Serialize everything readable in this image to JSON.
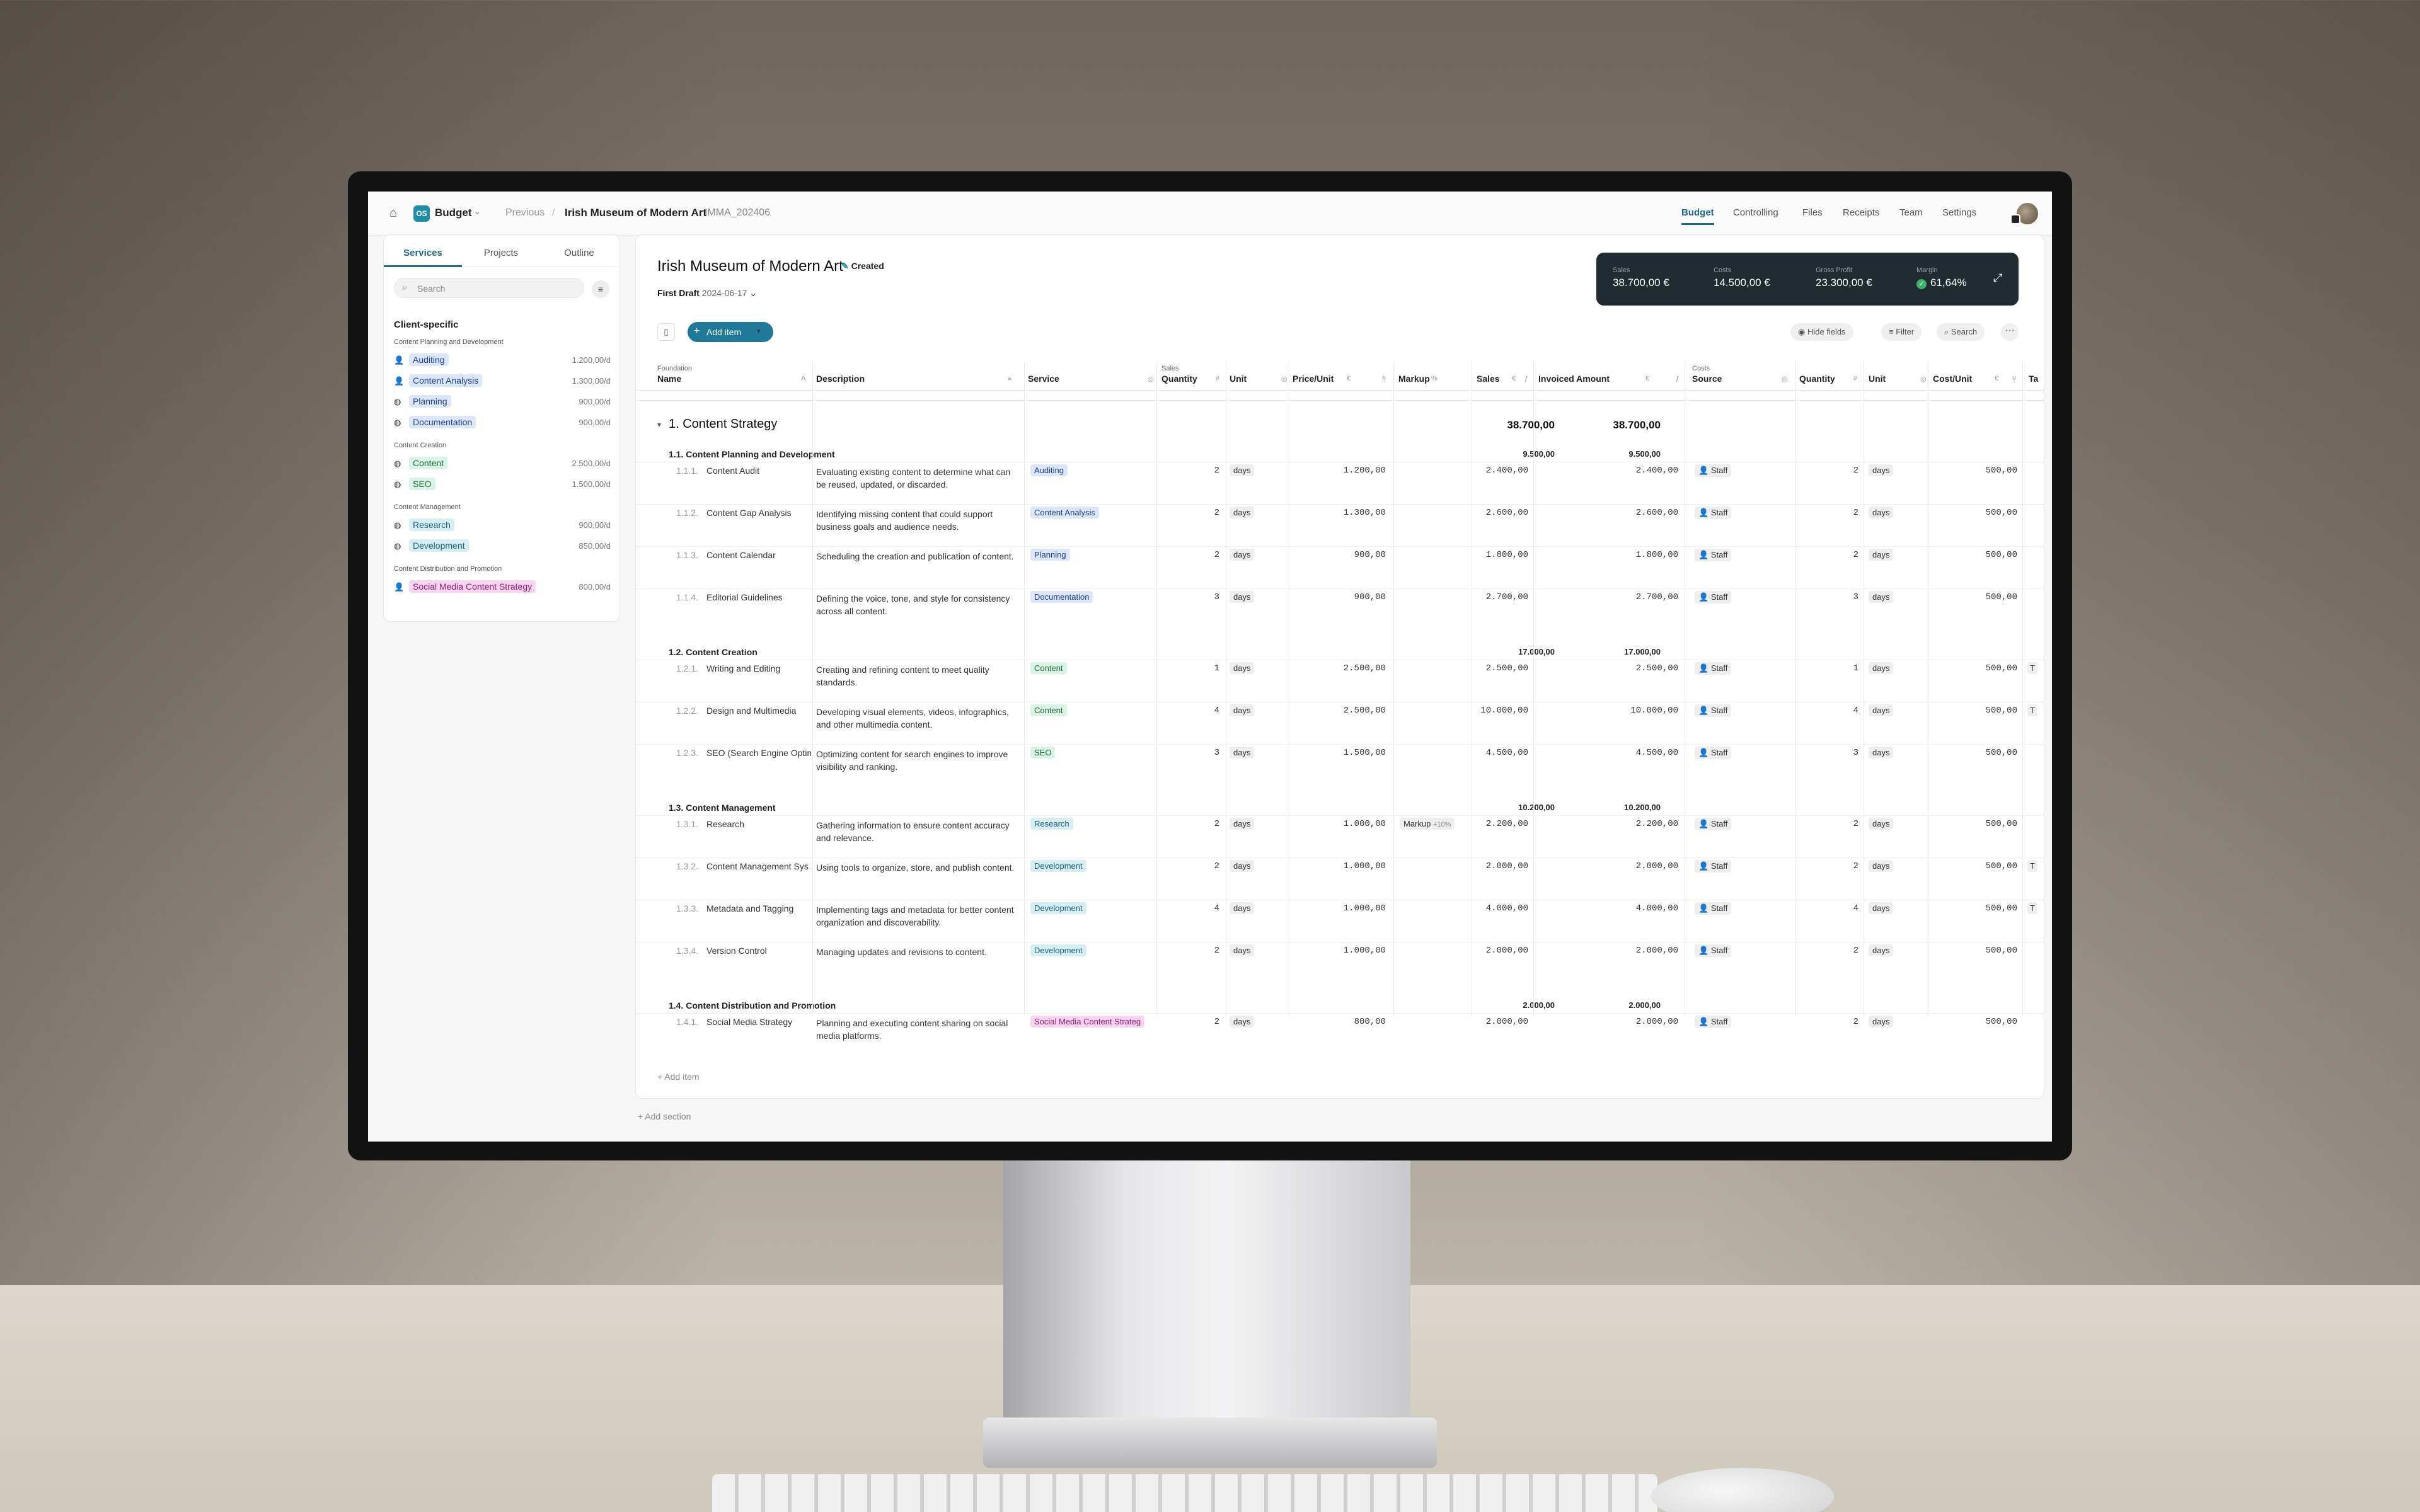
{
  "topbar": {
    "logo": "OS",
    "module": "Budget",
    "previous": "Previous",
    "separator": "/",
    "project": "Irish Museum of Modern Art",
    "code": "IMMA_202406",
    "nav": [
      "Budget",
      "Controlling",
      "Files",
      "Receipts",
      "Team",
      "Settings"
    ]
  },
  "sidebar": {
    "tabs": [
      "Services",
      "Projects",
      "Outline"
    ],
    "search_placeholder": "Search",
    "title": "Client-specific",
    "groups": [
      {
        "name": "Content Planning and Development",
        "items": [
          {
            "label": "Auditing",
            "rate": "1.200,00/d",
            "icon": "person-icon",
            "color": "blue"
          },
          {
            "label": "Content Analysis",
            "rate": "1.300,00/d",
            "icon": "person-icon",
            "color": "blue"
          },
          {
            "label": "Planning",
            "rate": "900,00/d",
            "icon": "globe-icon",
            "color": "blue"
          },
          {
            "label": "Documentation",
            "rate": "900,00/d",
            "icon": "globe-icon",
            "color": "blue"
          }
        ]
      },
      {
        "name": "Content Creation",
        "items": [
          {
            "label": "Content",
            "rate": "2.500,00/d",
            "icon": "globe-icon",
            "color": "green"
          },
          {
            "label": "SEO",
            "rate": "1.500,00/d",
            "icon": "globe-icon",
            "color": "green"
          }
        ]
      },
      {
        "name": "Content Management",
        "items": [
          {
            "label": "Research",
            "rate": "900,00/d",
            "icon": "globe-icon",
            "color": "teal"
          },
          {
            "label": "Development",
            "rate": "850,00/d",
            "icon": "globe-icon",
            "color": "teal"
          }
        ]
      },
      {
        "name": "Content Distribution and Promotion",
        "items": [
          {
            "label": "Social Media Content Strategy",
            "rate": "800,00/d",
            "icon": "person-icon",
            "color": "pink"
          }
        ]
      }
    ]
  },
  "main": {
    "title": "Irish Museum of Modern Art",
    "status": "Created",
    "draft": "First Draft",
    "draft_date": "2024-06-17",
    "kpis": [
      {
        "label": "Sales",
        "value": "38.700,00 €"
      },
      {
        "label": "Costs",
        "value": "14.500,00 €"
      },
      {
        "label": "Gross Profit",
        "value": "23.300,00 €"
      },
      {
        "label": "Margin",
        "value": "61,64%"
      }
    ],
    "add_item": "Add item",
    "hide_fields": "Hide fields",
    "filter": "Filter",
    "search": "Search",
    "col_groups": {
      "foundation": "Foundation",
      "sales": "Sales",
      "costs": "Costs"
    },
    "columns": [
      "Name",
      "Description",
      "Service",
      "Quantity",
      "Unit",
      "Price/Unit",
      "Markup",
      "Sales",
      "Invoiced Amount",
      "Source",
      "Quantity",
      "Unit",
      "Cost/Unit",
      "Ta"
    ],
    "column_icons": [
      "A",
      "≡",
      "◎",
      "#",
      "◎",
      "#",
      "◎",
      "ƒ",
      "ƒ",
      "◎",
      "#",
      "◎",
      "#"
    ],
    "column_units": {
      "price": "€",
      "markup": "%",
      "sales": "€",
      "invoiced": "€",
      "cost": "€"
    },
    "section": {
      "title": "1. Content Strategy",
      "sales": "38.700,00",
      "invoiced": "38.700,00"
    },
    "subsections": [
      {
        "title": "1.1. Content Planning and Development",
        "sales": "9.500,00",
        "invoiced": "9.500,00",
        "rows": [
          {
            "id": "1.1.1.",
            "name": "Content Audit",
            "desc": "Evaluating existing content to determine what can be reused, updated, or discarded.",
            "service": "Auditing",
            "color": "blue",
            "qty": "2",
            "unit": "days",
            "price": "1.200,00",
            "markup": "",
            "sales": "2.400,00",
            "inv": "2.400,00",
            "source": "Staff",
            "cqty": "2",
            "cunit": "days",
            "cost": "500,00",
            "tag": ""
          },
          {
            "id": "1.1.2.",
            "name": "Content Gap Analysis",
            "desc": "Identifying missing content that could support business goals and audience needs.",
            "service": "Content Analysis",
            "color": "blue",
            "qty": "2",
            "unit": "days",
            "price": "1.300,00",
            "markup": "",
            "sales": "2.600,00",
            "inv": "2.600,00",
            "source": "Staff",
            "cqty": "2",
            "cunit": "days",
            "cost": "500,00",
            "tag": ""
          },
          {
            "id": "1.1.3.",
            "name": "Content Calendar",
            "desc": "Scheduling the creation and publication of content.",
            "service": "Planning",
            "color": "blue",
            "qty": "2",
            "unit": "days",
            "price": "900,00",
            "markup": "",
            "sales": "1.800,00",
            "inv": "1.800,00",
            "source": "Staff",
            "cqty": "2",
            "cunit": "days",
            "cost": "500,00",
            "tag": ""
          },
          {
            "id": "1.1.4.",
            "name": "Editorial Guidelines",
            "desc": "Defining the voice, tone, and style for consistency across all content.",
            "service": "Documentation",
            "color": "blue",
            "qty": "3",
            "unit": "days",
            "price": "900,00",
            "markup": "",
            "sales": "2.700,00",
            "inv": "2.700,00",
            "source": "Staff",
            "cqty": "3",
            "cunit": "days",
            "cost": "500,00",
            "tag": ""
          }
        ]
      },
      {
        "title": "1.2. Content Creation",
        "sales": "17.000,00",
        "invoiced": "17.000,00",
        "rows": [
          {
            "id": "1.2.1.",
            "name": "Writing and Editing",
            "desc": "Creating and refining content to meet quality standards.",
            "service": "Content",
            "color": "green",
            "qty": "1",
            "unit": "days",
            "price": "2.500,00",
            "markup": "",
            "sales": "2.500,00",
            "inv": "2.500,00",
            "source": "Staff",
            "cqty": "1",
            "cunit": "days",
            "cost": "500,00",
            "tag": "T"
          },
          {
            "id": "1.2.2.",
            "name": "Design and Multimedia",
            "desc": "Developing visual elements, videos, infographics, and other multimedia content.",
            "service": "Content",
            "color": "green",
            "qty": "4",
            "unit": "days",
            "price": "2.500,00",
            "markup": "",
            "sales": "10.000,00",
            "inv": "10.000,00",
            "source": "Staff",
            "cqty": "4",
            "cunit": "days",
            "cost": "500,00",
            "tag": "T"
          },
          {
            "id": "1.2.3.",
            "name": "SEO (Search Engine Optim",
            "desc": "Optimizing content for search engines to improve visibility and ranking.",
            "service": "SEO",
            "color": "green",
            "qty": "3",
            "unit": "days",
            "price": "1.500,00",
            "markup": "",
            "sales": "4.500,00",
            "inv": "4.500,00",
            "source": "Staff",
            "cqty": "3",
            "cunit": "days",
            "cost": "500,00",
            "tag": ""
          }
        ]
      },
      {
        "title": "1.3. Content Management",
        "sales": "10.200,00",
        "invoiced": "10.200,00",
        "rows": [
          {
            "id": "1.3.1.",
            "name": "Research",
            "desc": "Gathering information to ensure content accuracy and relevance.",
            "service": "Research",
            "color": "teal",
            "qty": "2",
            "unit": "days",
            "price": "1.000,00",
            "markup": "Markup",
            "markup_val": "+10%",
            "sales": "2.200,00",
            "inv": "2.200,00",
            "source": "Staff",
            "cqty": "2",
            "cunit": "days",
            "cost": "500,00",
            "tag": ""
          },
          {
            "id": "1.3.2.",
            "name": "Content Management Sys",
            "desc": "Using tools to organize, store, and publish content.",
            "service": "Development",
            "color": "teal",
            "qty": "2",
            "unit": "days",
            "price": "1.000,00",
            "markup": "",
            "sales": "2.000,00",
            "inv": "2.000,00",
            "source": "Staff",
            "cqty": "2",
            "cunit": "days",
            "cost": "500,00",
            "tag": "T"
          },
          {
            "id": "1.3.3.",
            "name": "Metadata and Tagging",
            "desc": "Implementing tags and metadata for better content organization and discoverability.",
            "service": "Development",
            "color": "teal",
            "qty": "4",
            "unit": "days",
            "price": "1.000,00",
            "markup": "",
            "sales": "4.000,00",
            "inv": "4.000,00",
            "source": "Staff",
            "cqty": "4",
            "cunit": "days",
            "cost": "500,00",
            "tag": "T"
          },
          {
            "id": "1.3.4.",
            "name": "Version Control",
            "desc": "Managing updates and revisions to content.",
            "service": "Development",
            "color": "teal",
            "qty": "2",
            "unit": "days",
            "price": "1.000,00",
            "markup": "",
            "sales": "2.000,00",
            "inv": "2.000,00",
            "source": "Staff",
            "cqty": "2",
            "cunit": "days",
            "cost": "500,00",
            "tag": ""
          }
        ]
      },
      {
        "title": "1.4. Content Distribution and Promotion",
        "sales": "2.000,00",
        "invoiced": "2.000,00",
        "rows": [
          {
            "id": "1.4.1.",
            "name": "Social Media Strategy",
            "desc": "Planning and executing content sharing on social media platforms.",
            "service": "Social Media Content Strateg",
            "color": "pink",
            "qty": "2",
            "unit": "days",
            "price": "800,00",
            "markup": "",
            "sales": "2.000,00",
            "inv": "2.000,00",
            "source": "Staff",
            "cqty": "2",
            "cunit": "days",
            "cost": "500,00",
            "tag": ""
          }
        ]
      }
    ],
    "add_row": "Add item",
    "add_section": "Add section"
  },
  "colors": {
    "accent": "#1e7a98",
    "kpi_bg": "#1f2b30",
    "blue": "#dce6fb",
    "green": "#d9f3e4",
    "teal": "#d6eef3",
    "pink": "#f9d3f0"
  }
}
